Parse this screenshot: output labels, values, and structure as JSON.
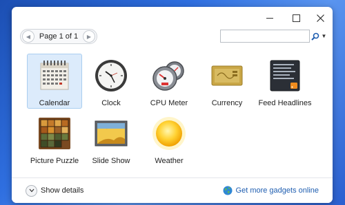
{
  "window": {
    "controls": {
      "minimize": "minimize",
      "maximize": "maximize",
      "close": "close"
    }
  },
  "pager": {
    "label": "Page 1 of 1",
    "prev_icon": "chevron-left-icon",
    "next_icon": "chevron-right-icon"
  },
  "search": {
    "value": "",
    "placeholder": "",
    "icon": "search-icon"
  },
  "gadgets": [
    {
      "label": "Calendar",
      "selected": true
    },
    {
      "label": "Clock",
      "selected": false
    },
    {
      "label": "CPU Meter",
      "selected": false
    },
    {
      "label": "Currency",
      "selected": false
    },
    {
      "label": "Feed Headlines",
      "selected": false
    },
    {
      "label": "Picture Puzzle",
      "selected": false
    },
    {
      "label": "Slide Show",
      "selected": false
    },
    {
      "label": "Weather",
      "selected": false
    }
  ],
  "footer": {
    "show_details": "Show details",
    "get_more": "Get more gadgets online"
  },
  "colors": {
    "accent": "#1e5db0",
    "selection_bg": "#dcebfb",
    "selection_border": "#a9cdf0"
  }
}
